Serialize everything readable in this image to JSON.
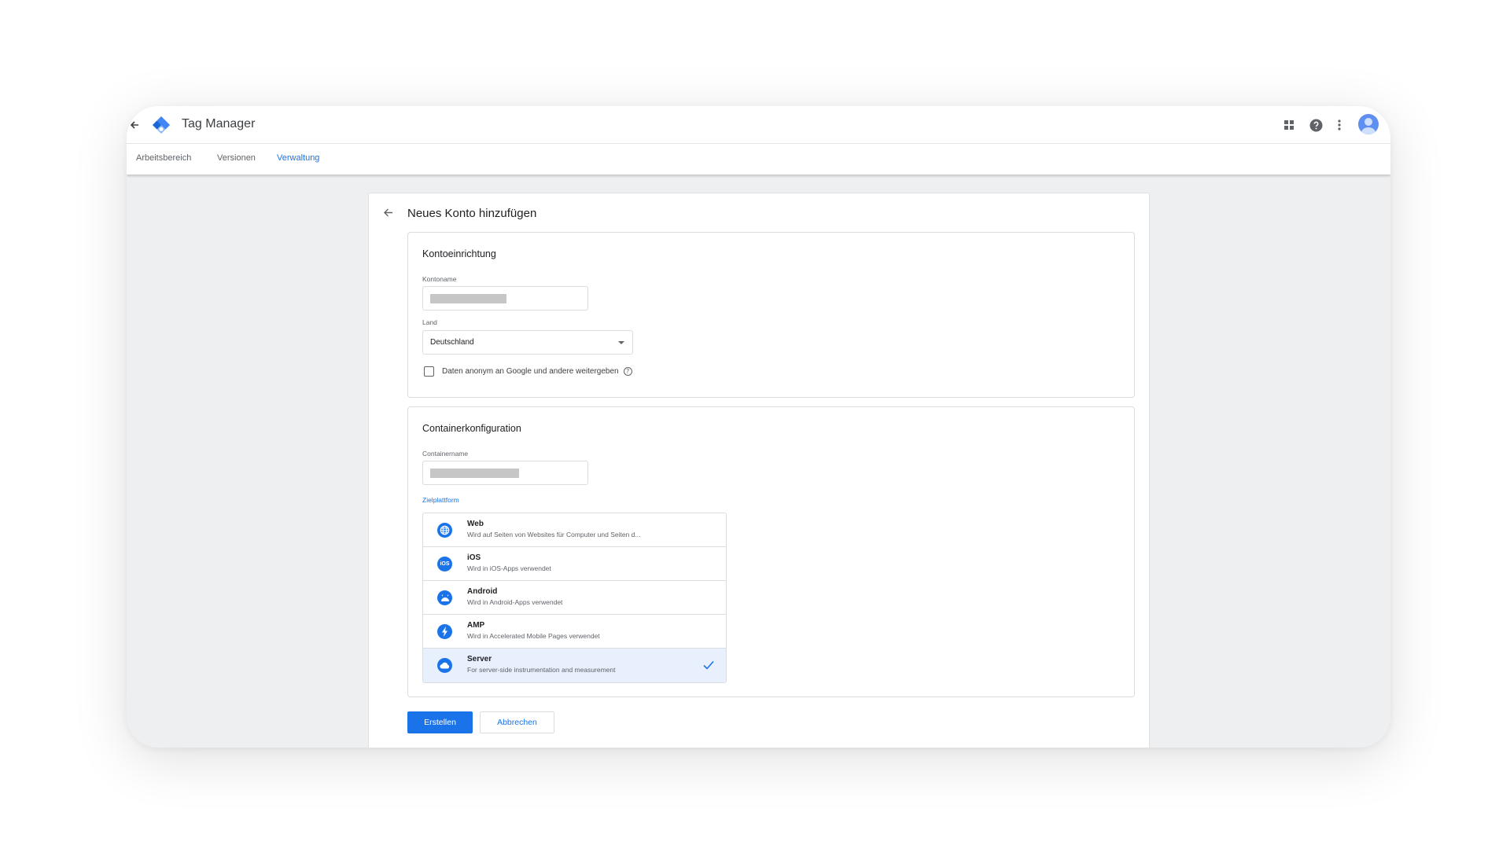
{
  "app": {
    "title": "Tag Manager"
  },
  "tabs": [
    {
      "label": "Arbeitsbereich"
    },
    {
      "label": "Versionen"
    },
    {
      "label": "Verwaltung",
      "active": true
    }
  ],
  "page": {
    "title": "Neues Konto hinzufügen"
  },
  "account_setup": {
    "title": "Kontoeinrichtung",
    "account_name_label": "Kontoname",
    "country_label": "Land",
    "country_value": "Deutschland",
    "share_data_label": "Daten anonym an Google und andere weitergeben",
    "share_data_checked": false
  },
  "container_setup": {
    "title": "Containerkonfiguration",
    "container_name_label": "Containername",
    "target_platform_label": "Zielplattform",
    "platforms": [
      {
        "name": "Web",
        "description": "Wird auf Seiten von Websites für Computer und Seiten d...",
        "icon": "globe-icon",
        "selected": false
      },
      {
        "name": "iOS",
        "description": "Wird in iOS-Apps verwendet",
        "icon": "ios-icon",
        "selected": false
      },
      {
        "name": "Android",
        "description": "Wird in Android-Apps verwendet",
        "icon": "android-icon",
        "selected": false
      },
      {
        "name": "AMP",
        "description": "Wird in Accelerated Mobile Pages verwendet",
        "icon": "amp-bolt-icon",
        "selected": false
      },
      {
        "name": "Server",
        "description": "For server-side instrumentation and measurement",
        "icon": "cloud-icon",
        "selected": true
      }
    ]
  },
  "actions": {
    "create_label": "Erstellen",
    "cancel_label": "Abbrechen"
  },
  "colors": {
    "accent": "#1a73e8",
    "selected_row": "#e8f0fe"
  }
}
